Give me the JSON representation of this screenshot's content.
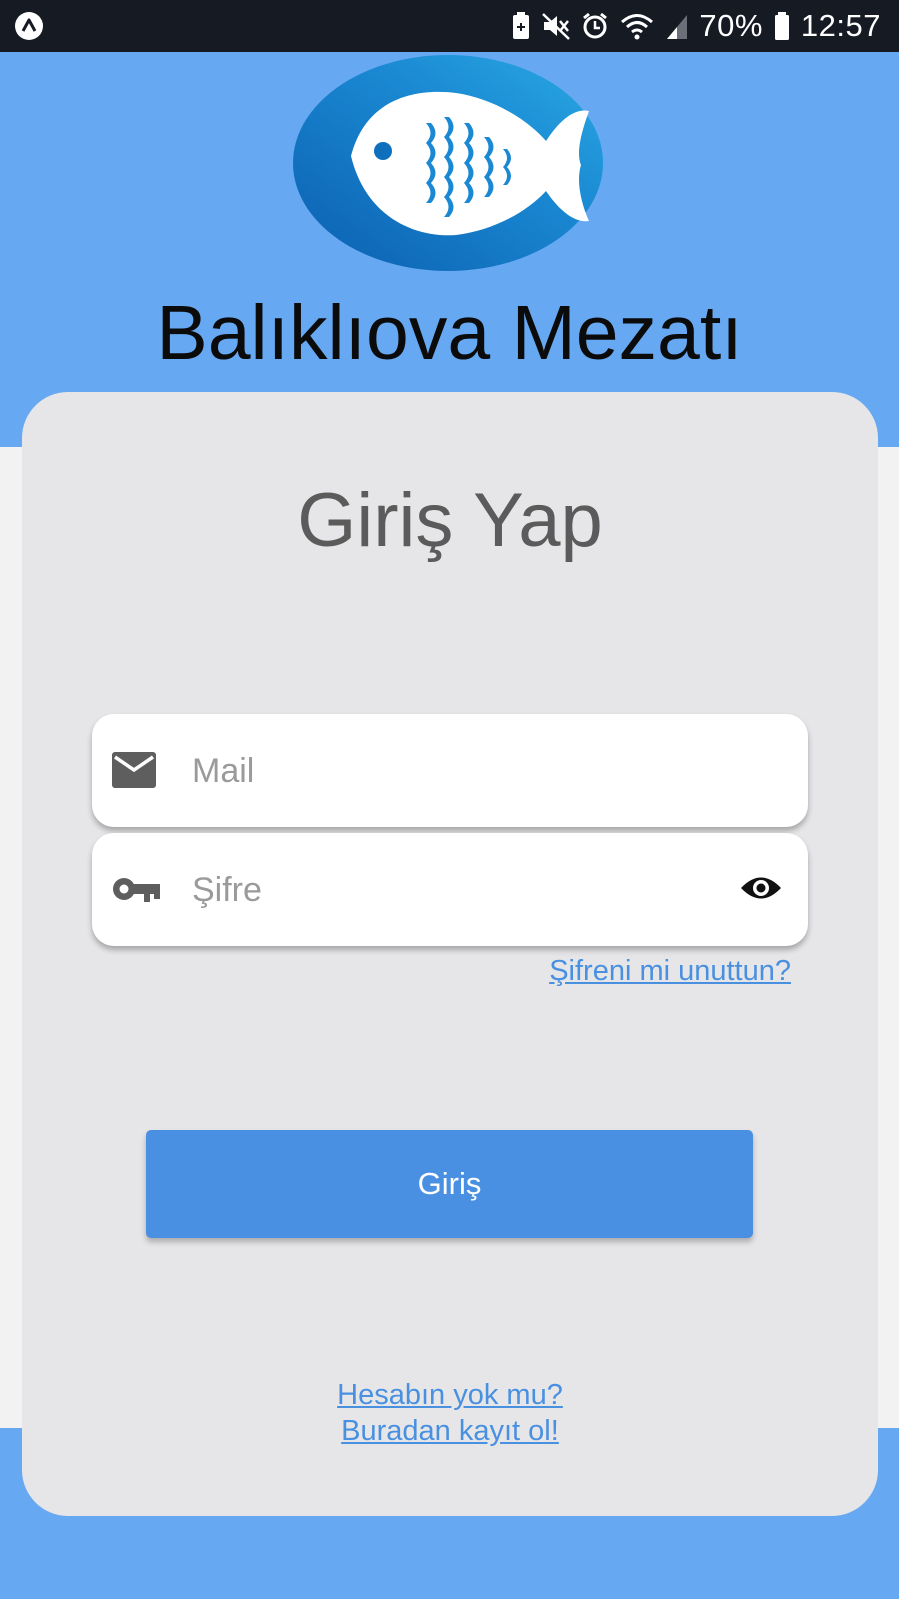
{
  "status_bar": {
    "battery": "70%",
    "time": "12:57",
    "icons": [
      "app-icon",
      "notification-icon",
      "mute-icon",
      "alarm-icon",
      "wifi-icon",
      "signal-icon",
      "battery-icon"
    ]
  },
  "header": {
    "logo": "fish-logo",
    "app_name": "Balıklıova Mezatı"
  },
  "login": {
    "title": "Giriş Yap",
    "email_placeholder": "Mail",
    "email_value": "",
    "password_placeholder": "Şifre",
    "password_value": "",
    "forgot_link": "Şifreni mi unuttun?",
    "submit_label": "Giriş",
    "register_line1": "Hesabın yok mu?",
    "register_line2": "Buradan kayıt ol!"
  },
  "colors": {
    "brand_blue": "#66a8f1",
    "button_blue": "#4a90e2",
    "link_blue": "#4a90e0",
    "card_bg": "#e6e6e8",
    "status_bar_bg": "#151a23"
  }
}
